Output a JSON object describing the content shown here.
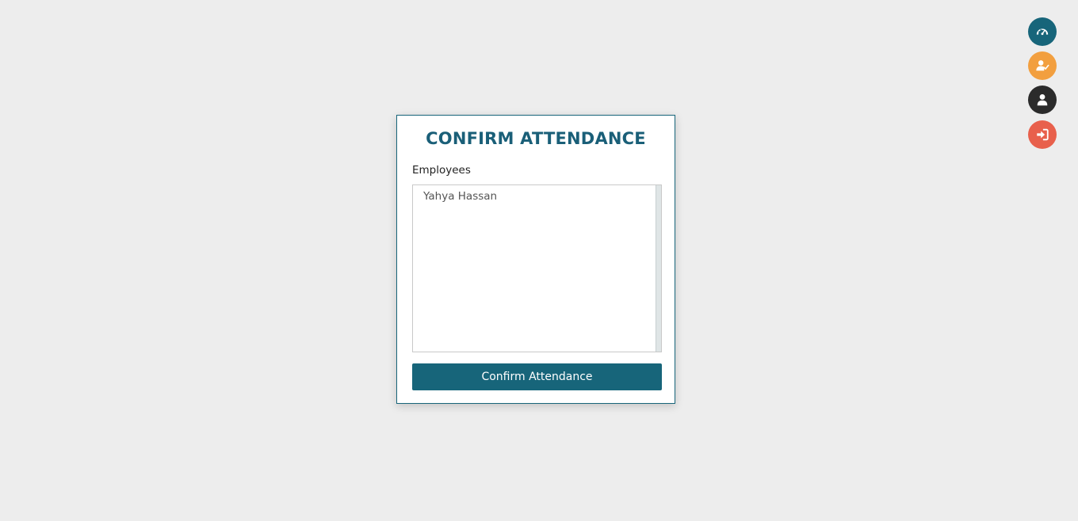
{
  "card": {
    "title": "CONFIRM ATTENDANCE",
    "employees_label": "Employees",
    "employees": [
      "Yahya Hassan"
    ],
    "confirm_button_label": "Confirm Attendance"
  },
  "floating_actions": [
    {
      "icon": "dashboard-gauge-icon",
      "color": "#17657a"
    },
    {
      "icon": "user-check-icon",
      "color": "#f29f3f"
    },
    {
      "icon": "user-icon",
      "color": "#2b2b2b"
    },
    {
      "icon": "sign-in-icon",
      "color": "#e8604c"
    }
  ],
  "colors": {
    "primary": "#17657a",
    "background": "#ededed"
  }
}
